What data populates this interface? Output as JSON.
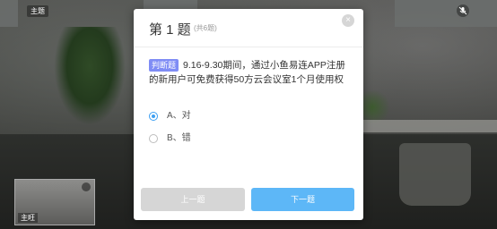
{
  "video": {
    "host_label": "主题",
    "thumb_host_label": "主旺"
  },
  "quiz": {
    "title": "第 1 题",
    "count": "(共6题)",
    "close_icon": "×",
    "type_label": "判断题",
    "question": "9.16-9.30期间，通过小鱼易连APP注册的新用户可免费获得50方云会议室1个月使用权",
    "options": [
      {
        "label": "A、对",
        "selected": true
      },
      {
        "label": "B、错",
        "selected": false
      }
    ],
    "prev_label": "上一题",
    "next_label": "下一题",
    "accent_color": "#3ea0f2",
    "type_color": "#7f8cf5"
  }
}
